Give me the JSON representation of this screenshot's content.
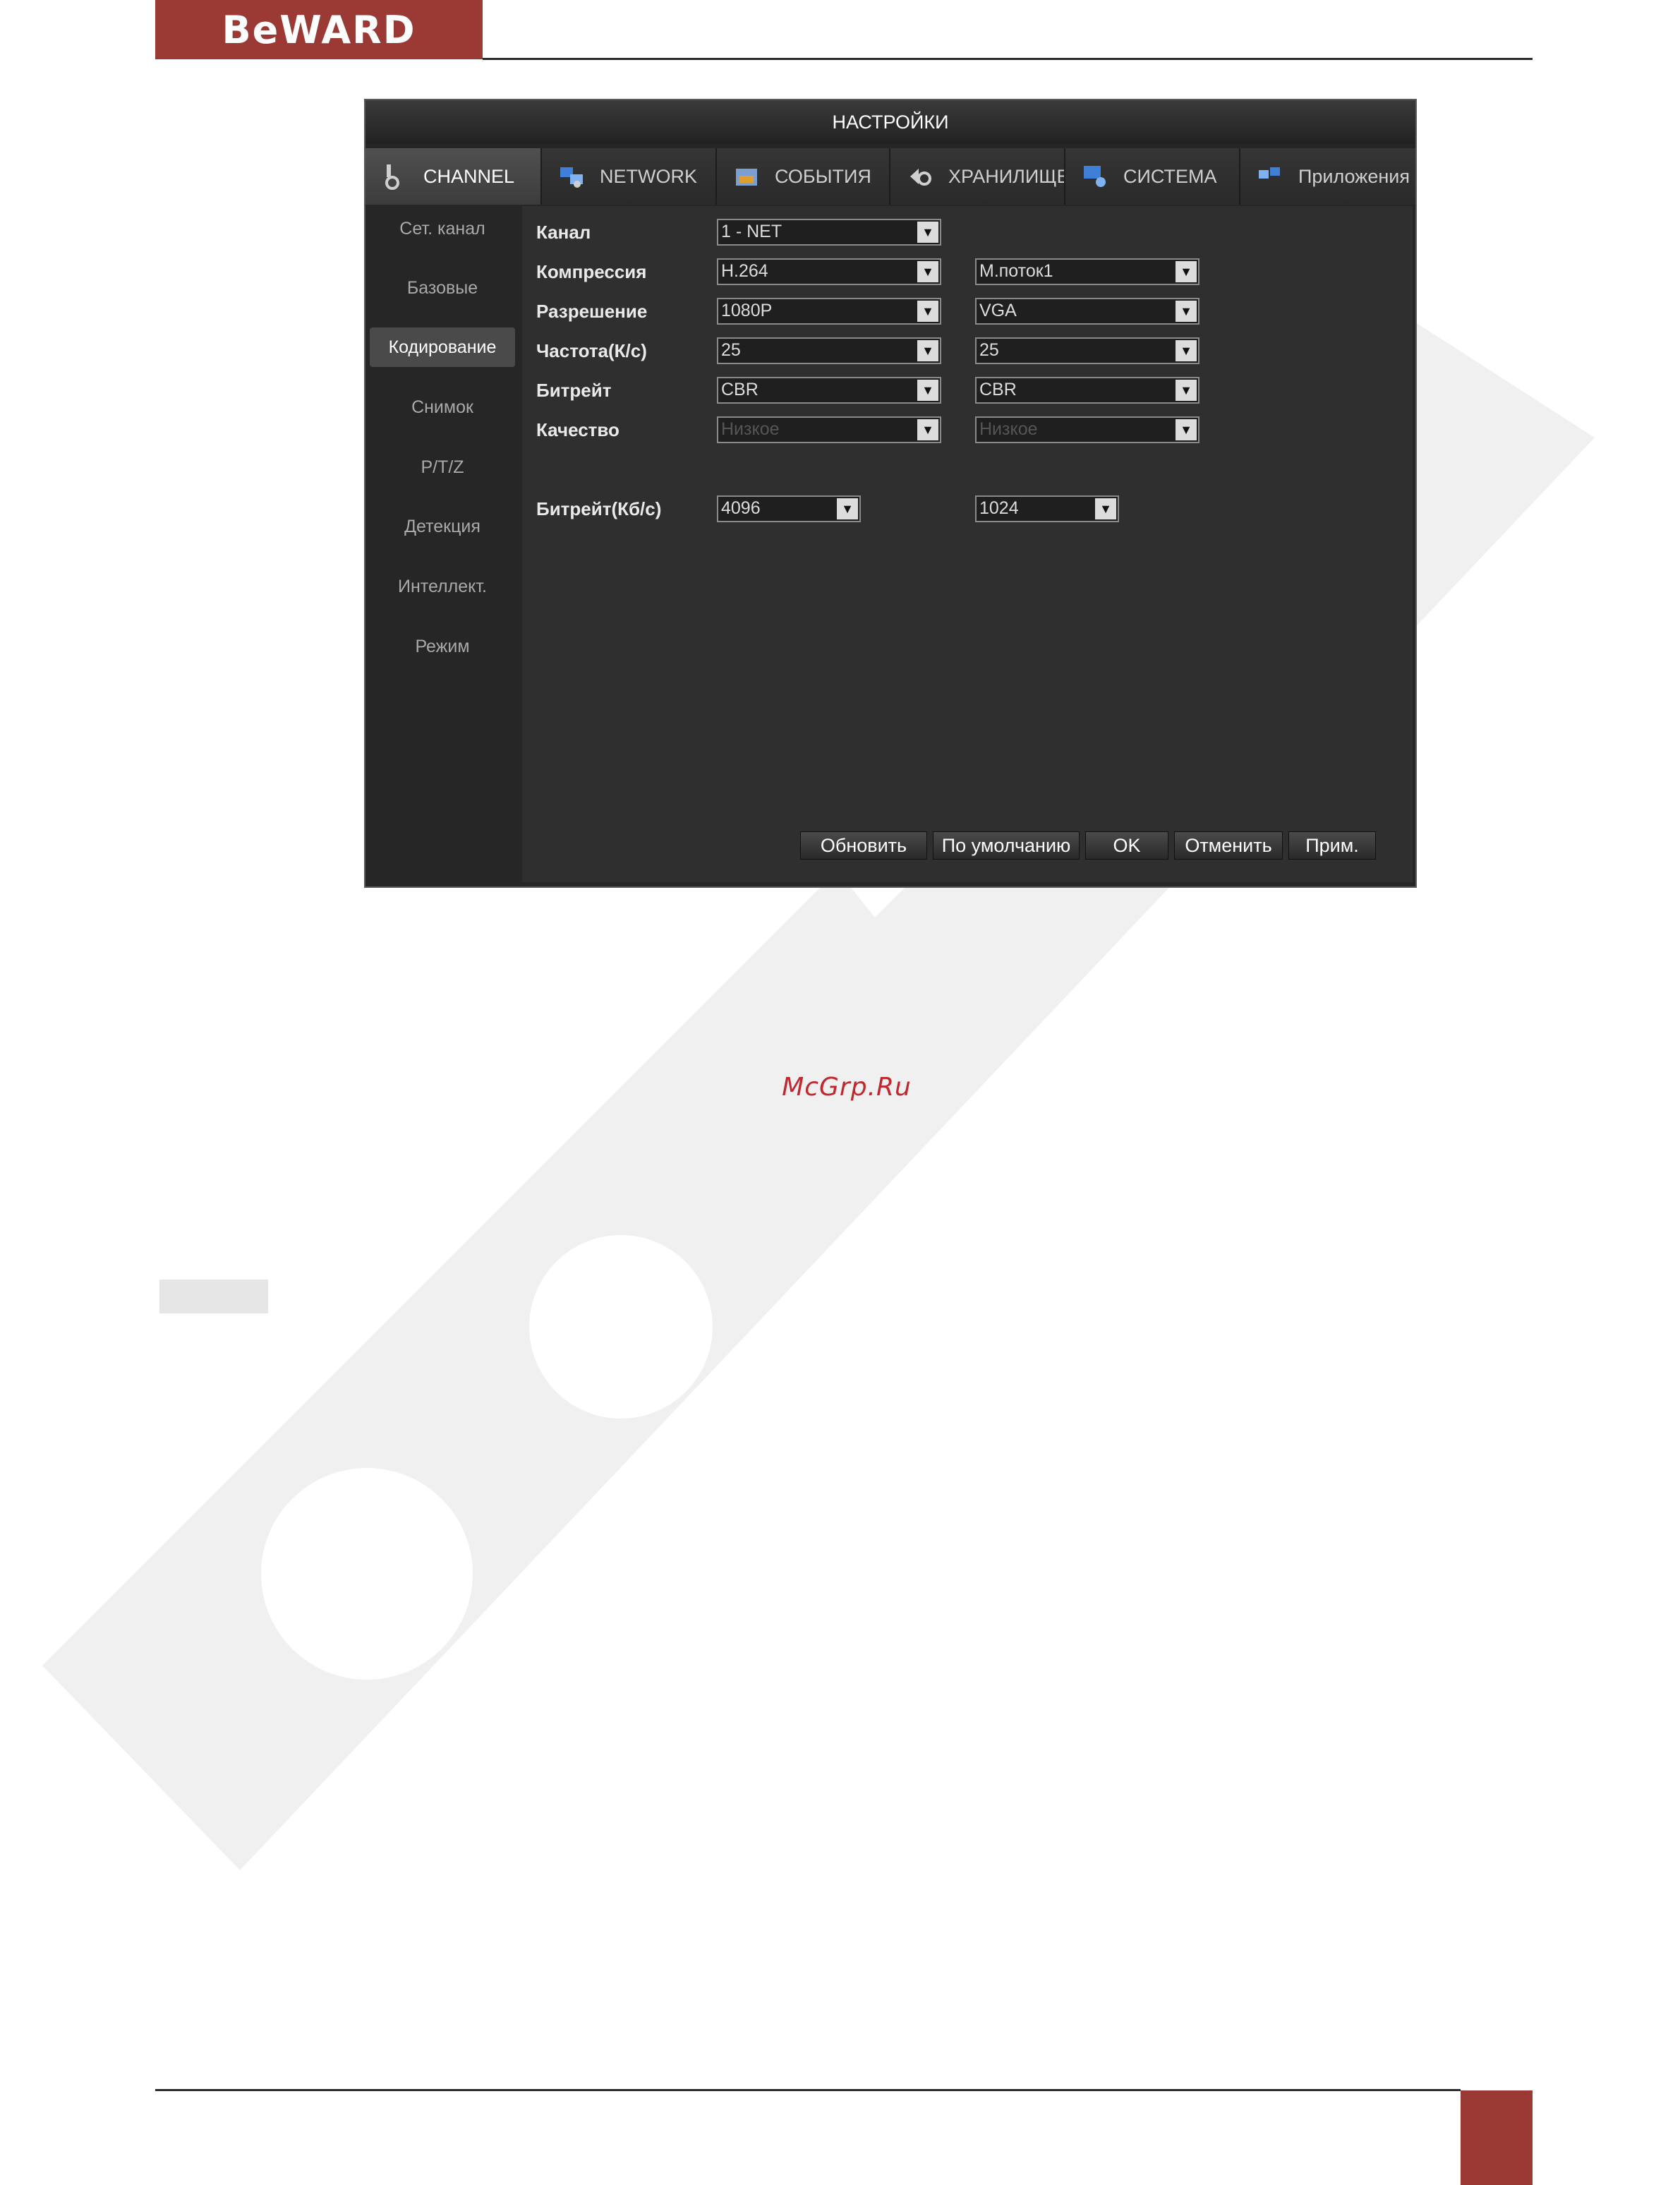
{
  "header": {
    "logo": "BeWARD"
  },
  "watermark_site": "McGrp.Ru",
  "window": {
    "title": "НАСТРОЙКИ",
    "tabs": [
      {
        "label": "CHANNEL",
        "icon": "camera-icon",
        "active": true
      },
      {
        "label": "NETWORK",
        "icon": "network-icon",
        "active": false
      },
      {
        "label": "СОБЫТИЯ",
        "icon": "events-icon",
        "active": false
      },
      {
        "label": "ХРАНИЛИЩЕ",
        "icon": "storage-icon",
        "active": false
      },
      {
        "label": "СИСТЕМА",
        "icon": "system-icon",
        "active": false
      },
      {
        "label": "Приложения",
        "icon": "apps-icon",
        "active": false
      }
    ],
    "sidebar": [
      "Сет. канал",
      "Базовые",
      "Кодирование",
      "Снимок",
      "P/T/Z",
      "Детекция",
      "Интеллект.",
      "Режим"
    ],
    "sidebar_active": "Кодирование",
    "fields": {
      "channel": {
        "label": "Канал",
        "value": "1 - NET"
      },
      "compression": {
        "label": "Компрессия",
        "main": "H.264",
        "sub": "M.поток1"
      },
      "resolution": {
        "label": "Разрешение",
        "main": "1080P",
        "sub": "VGA"
      },
      "framerate": {
        "label": "Частота(К/с)",
        "main": "25",
        "sub": "25"
      },
      "bitrate_mode": {
        "label": "Битрейт",
        "main": "CBR",
        "sub": "CBR"
      },
      "quality": {
        "label": "Качество",
        "main": "Низкое",
        "sub": "Низкое"
      },
      "bitrate_kbps": {
        "label": "Битрейт(Кб/с)",
        "main": "4096",
        "sub": "1024"
      }
    },
    "buttons": {
      "refresh": "Обновить",
      "default": "По умолчанию",
      "ok": "OK",
      "cancel": "Отменить",
      "apply": "Прим."
    }
  }
}
